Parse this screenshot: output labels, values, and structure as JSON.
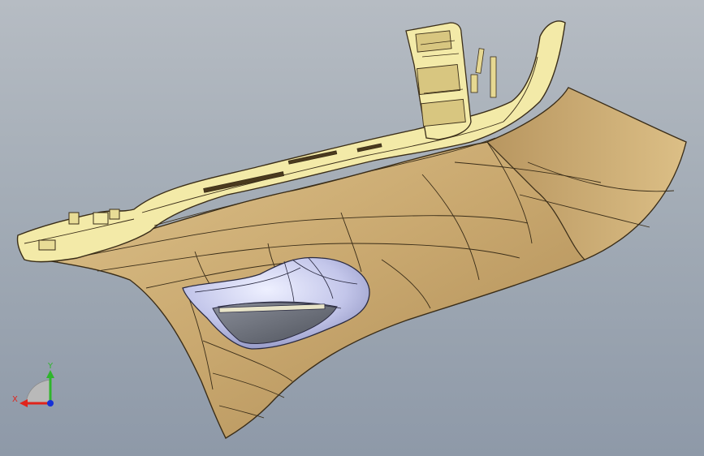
{
  "viewport": {
    "background_top": "#b6bcc3",
    "background_bottom": "#8e99a8"
  },
  "model": {
    "part_color": "#c9aa73",
    "rim_color": "#f3eaa8",
    "edge_color": "#3a2d18",
    "pocket_color": "#c7c9e8",
    "pocket_floor_color": "#6f7380"
  },
  "triad": {
    "x_label": "X",
    "y_label": "Y",
    "x_color": "#e0241c",
    "y_color": "#2fb52c",
    "z_color": "#1530d8"
  }
}
